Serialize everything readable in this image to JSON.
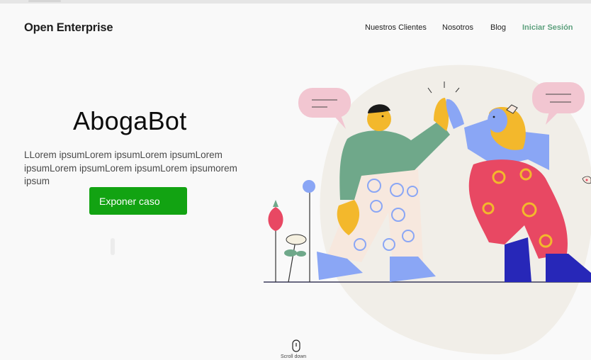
{
  "header": {
    "logo": "Open Enterprise",
    "nav": [
      "Nuestros Clientes",
      "Nosotros",
      "Blog"
    ],
    "login": "Iniciar Sesión"
  },
  "hero": {
    "title": "AbogaBot",
    "body": "LLorem ipsumLorem ipsumLorem ipsumLorem ipsumLorem ipsumLorem ipsumLorem ipsumorem ipsum",
    "cta_label": "Exponer caso"
  },
  "footer": {
    "scroll_label": "Scroll down"
  },
  "colors": {
    "brand_green": "#5ea17e",
    "cta_green": "#12a312",
    "blob": "#f1eee8",
    "sweater": "#6fa88a",
    "skin": "#f3b82c",
    "pants_red": "#e84863",
    "shoe_blue": "#8aa6f5",
    "boot_navy": "#2727b8",
    "bubble_pink": "#f2c6d1"
  },
  "icons": [
    "mouse-icon"
  ]
}
